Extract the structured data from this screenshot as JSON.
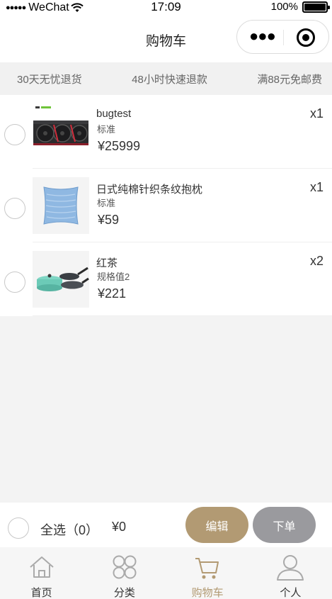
{
  "status_bar": {
    "carrier": "WeChat",
    "time": "17:09",
    "battery": "100%"
  },
  "nav": {
    "title": "购物车"
  },
  "promo": [
    "30天无忧退货",
    "48小时快速退款",
    "满88元免邮费"
  ],
  "items": [
    {
      "name": "bugtest",
      "spec": "标准",
      "price": "¥25999",
      "qty": "x1",
      "image": "graphics-card-image"
    },
    {
      "name": "日式纯棉针织条纹抱枕",
      "spec": "标准",
      "price": "¥59",
      "qty": "x1",
      "image": "pillow-image"
    },
    {
      "name": "红茶",
      "spec": "规格值2",
      "price": "¥221",
      "qty": "x2",
      "image": "cookware-set-image"
    }
  ],
  "footer": {
    "select_all": "全选（0）",
    "total": "¥0",
    "edit_label": "编辑",
    "order_label": "下单"
  },
  "tabs": [
    {
      "label": "首页",
      "icon": "home-icon"
    },
    {
      "label": "分类",
      "icon": "category-icon"
    },
    {
      "label": "购物车",
      "icon": "cart-icon",
      "active": true
    },
    {
      "label": "个人",
      "icon": "user-icon"
    }
  ],
  "colors": {
    "accent": "#b29a73",
    "disabled_button": "#9a9a9e"
  }
}
